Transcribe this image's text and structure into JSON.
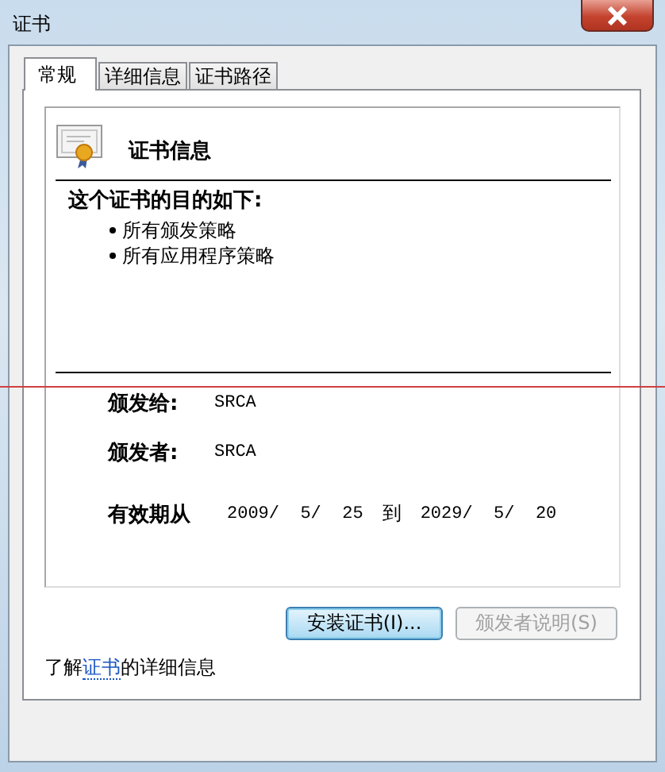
{
  "window": {
    "title": "证书"
  },
  "tabs": [
    {
      "label": "常规",
      "selected": true
    },
    {
      "label": "详细信息",
      "selected": false
    },
    {
      "label": "证书路径",
      "selected": false
    }
  ],
  "certificate_info": {
    "heading": "证书信息",
    "purpose_title": "这个证书的目的如下:",
    "purposes": [
      "所有颁发策略",
      "所有应用程序策略"
    ],
    "fields": [
      {
        "label": "颁发给:",
        "value": "SRCA"
      },
      {
        "label": "颁发者:",
        "value": "SRCA"
      }
    ],
    "validity": {
      "label": "有效期从",
      "from": "2009/  5/  25",
      "to_word": "到",
      "to": "2029/  5/  20"
    }
  },
  "buttons": [
    {
      "label": "安装证书(I)...",
      "disabled": false
    },
    {
      "label": "颁发者说明(S)",
      "disabled": true
    }
  ],
  "learn_more": {
    "before": "了解",
    "link": "证书",
    "after": "的详细信息"
  }
}
